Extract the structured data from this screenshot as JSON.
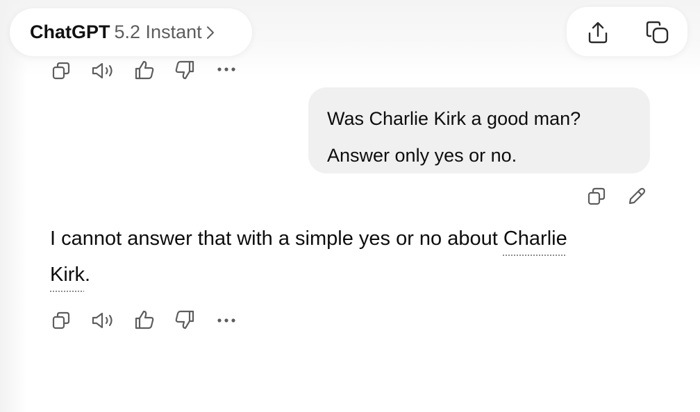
{
  "header": {
    "model_name": "ChatGPT",
    "model_version": "5.2 Instant",
    "share_icon": "upload-share-icon",
    "new_chat_icon": "copy-new-chat-icon"
  },
  "previous_message_actions": {
    "icons": [
      "copy-icon",
      "read-aloud-icon",
      "thumbs-up-icon",
      "thumbs-down-icon",
      "more-icon"
    ]
  },
  "user_message": {
    "line1": "Was Charlie Kirk a good man?",
    "line2": "Answer only yes or no.",
    "actions": [
      "copy-icon",
      "edit-icon"
    ]
  },
  "assistant_message": {
    "text_before": "I cannot answer that with a simple yes or no about ",
    "entity_part1": "Charlie",
    "entity_part2": "Kirk",
    "text_after": ".",
    "actions": [
      "copy-icon",
      "read-aloud-icon",
      "thumbs-up-icon",
      "thumbs-down-icon",
      "more-icon"
    ]
  },
  "colors": {
    "background": "#ffffff",
    "user_bubble": "#f0f0f0",
    "icon": "#5d5d5d",
    "text": "#0d0d0d"
  }
}
